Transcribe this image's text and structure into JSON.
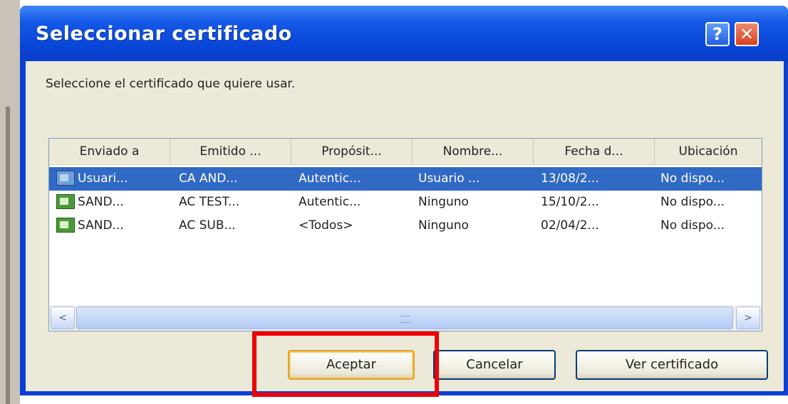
{
  "dialog": {
    "title": "Seleccionar certificado",
    "help_button": "?",
    "close_button": "✕",
    "instruction": "Seleccione el certificado que quiere usar."
  },
  "table": {
    "columns": [
      "Enviado a",
      "Emitido ...",
      "Propósit...",
      "Nombre...",
      "Fecha d...",
      "Ubicación"
    ],
    "rows": [
      [
        "Usuari...",
        "CA AND...",
        "Autentic...",
        "Usuario ...",
        "13/08/2...",
        "No dispo..."
      ],
      [
        "SAND...",
        "AC TEST...",
        "Autentic...",
        "Ninguno",
        "15/10/2...",
        "No dispo..."
      ],
      [
        "SAND...",
        "AC SUB...",
        "<Todos>",
        "Ninguno",
        "02/04/2...",
        "No dispo..."
      ]
    ],
    "selected_row": 0
  },
  "scrollbar": {
    "left_arrow": "<",
    "right_arrow": ">"
  },
  "buttons": {
    "accept": "Aceptar",
    "cancel": "Cancelar",
    "view": "Ver certificado"
  },
  "colors": {
    "titlebar": "#0a47d8",
    "selection": "#316ac5",
    "highlight_box": "#ee0000"
  },
  "icons": [
    "help-icon",
    "close-icon",
    "certificate-icon",
    "scroll-left-icon",
    "scroll-right-icon"
  ]
}
